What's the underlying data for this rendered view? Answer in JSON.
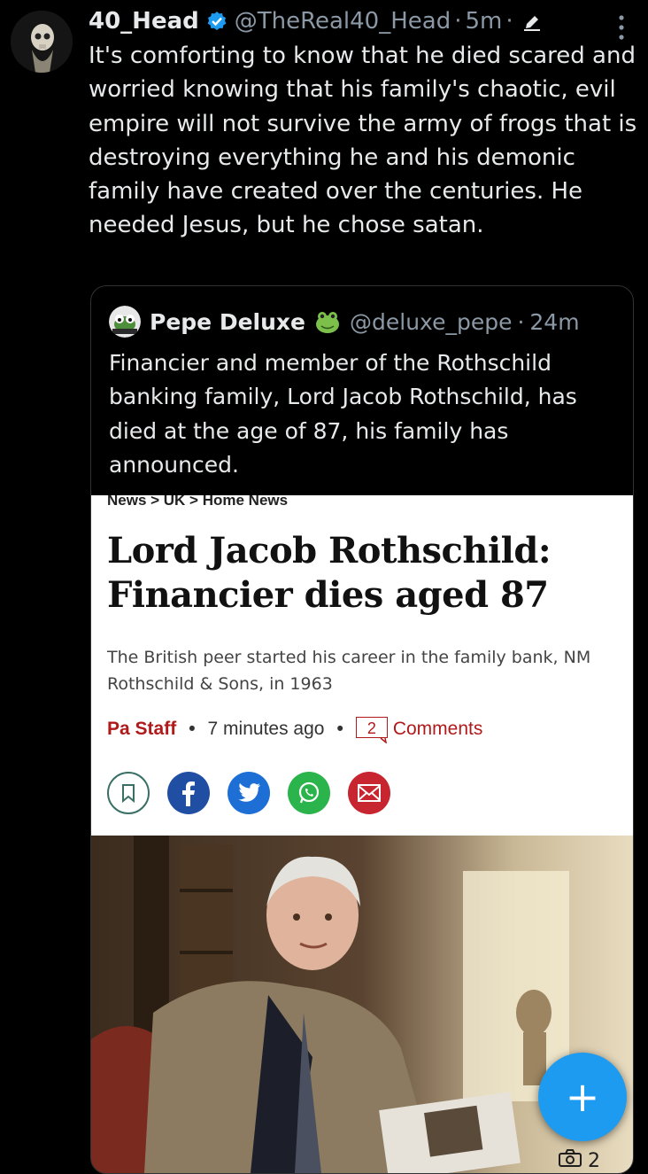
{
  "tweet": {
    "author_name": "40_Head",
    "author_handle": "@TheReal40_Head",
    "separator": "·",
    "time": "5m",
    "text": "It's comforting to know that he died scared and worried knowing that his family's chaotic, evil empire will not survive the army of frogs that is destroying everything he and his demonic family have created over the centuries. He needed Jesus, but he chose satan."
  },
  "quote": {
    "author_name": "Pepe Deluxe",
    "author_handle": "@deluxe_pepe",
    "separator": "·",
    "time": "24m",
    "text": "Financier and member of the Rothschild banking family, Lord Jacob Rothschild, has died at the age of 87, his family has announced."
  },
  "article": {
    "breadcrumb": "News > UK > Home News",
    "headline": "Lord Jacob Rothschild: Financier dies aged 87",
    "subhead": "The British peer started his career in the family bank, NM Rothschild & Sons, in 1963",
    "author": "Pa Staff",
    "bullet": "•",
    "time_ago": "7 minutes ago",
    "comment_count": "2",
    "comments_label": "Comments"
  },
  "fab": {
    "label": "+"
  },
  "media": {
    "photo_count": "2"
  },
  "colors": {
    "accent": "#1d9bf0",
    "article_red": "#b01a1a",
    "muted": "#8b98a5"
  }
}
